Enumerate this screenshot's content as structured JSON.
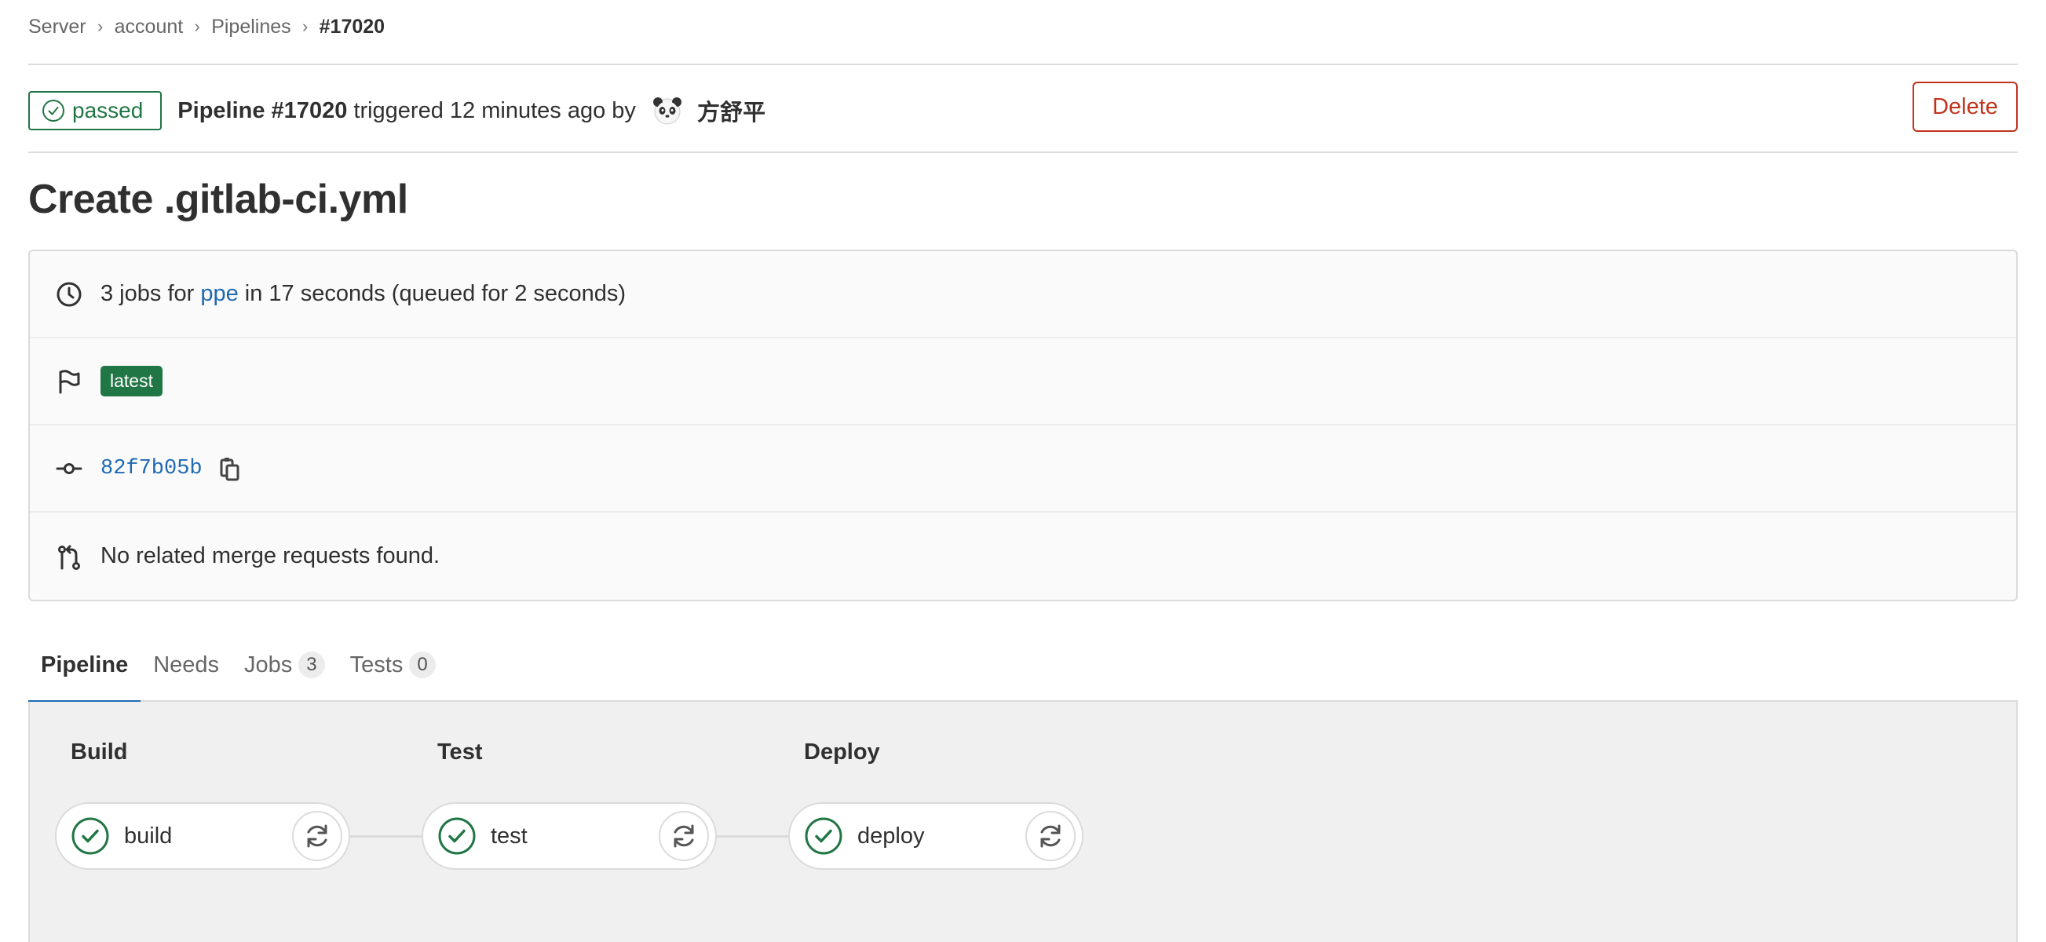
{
  "breadcrumb": {
    "items": [
      "Server",
      "account",
      "Pipelines",
      "#17020"
    ],
    "separator": "›"
  },
  "header": {
    "status_label": "passed",
    "status_color": "#217645",
    "pipeline_id": "Pipeline #17020",
    "triggered_text": " triggered 12 minutes ago by ",
    "avatar_icon": "panda-avatar",
    "username": "方舒平",
    "delete_label": "Delete",
    "delete_color": "#c0341d"
  },
  "title": "Create .gitlab-ci.yml",
  "info": {
    "jobs_prefix": "3 jobs for ",
    "branch": "ppe",
    "jobs_suffix": " in 17 seconds (queued for 2 seconds)",
    "tag_label": "latest",
    "commit_sha": "82f7b05b",
    "merge_text": "No related merge requests found."
  },
  "tabs": [
    {
      "label": "Pipeline",
      "count": null
    },
    {
      "label": "Needs",
      "count": null
    },
    {
      "label": "Jobs",
      "count": "3"
    },
    {
      "label": "Tests",
      "count": "0"
    }
  ],
  "stages": [
    {
      "title": "Build",
      "job": "build",
      "status": "success"
    },
    {
      "title": "Test",
      "job": "test",
      "status": "success"
    },
    {
      "title": "Deploy",
      "job": "deploy",
      "status": "success"
    }
  ],
  "colors": {
    "success": "#217645",
    "link": "#1f69b3",
    "danger": "#c0341d",
    "active_tab": "#1f69b3"
  }
}
